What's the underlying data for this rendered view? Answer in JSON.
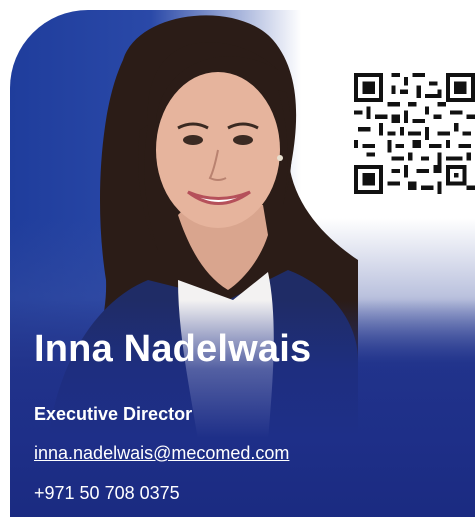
{
  "profile": {
    "name": "Inna Nadelwais",
    "title": "Executive Director",
    "email": "inna.nadelwais@mecomed.com",
    "phone": "+971 50 708 0375"
  },
  "colors": {
    "accent_blue": "#1e2f88",
    "text_white": "#ffffff"
  },
  "icons": {
    "qr": "qr-code-icon"
  }
}
